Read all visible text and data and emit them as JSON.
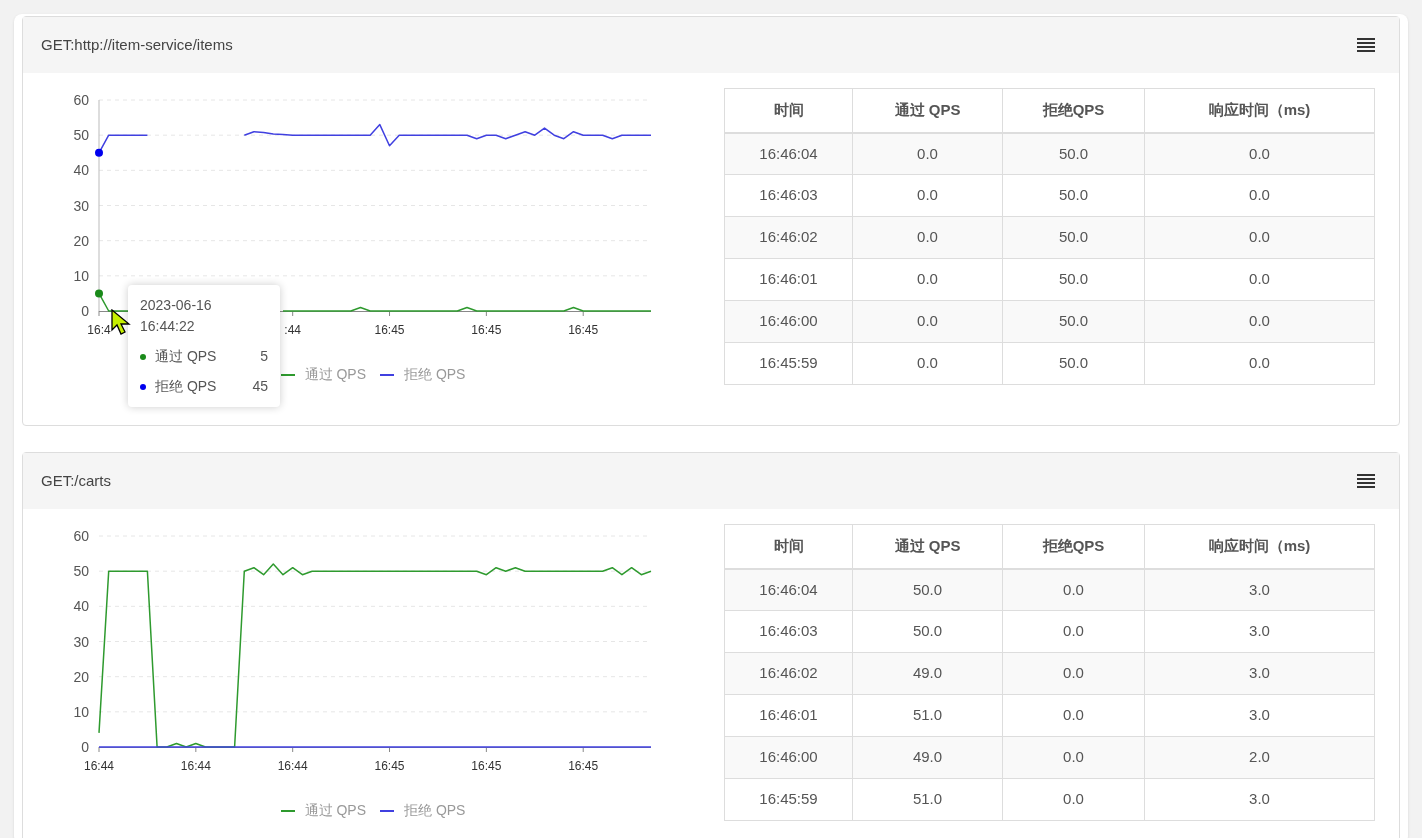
{
  "panels": [
    {
      "title": "GET:http://item-service/items",
      "chart_data": {
        "type": "line",
        "categories": [
          "16:4",
          null,
          null,
          null,
          null,
          null,
          null,
          null,
          null,
          null,
          null,
          null,
          null,
          null,
          null,
          null,
          null,
          null,
          null,
          null,
          ":44",
          null,
          null,
          null,
          null,
          null,
          null,
          null,
          null,
          null,
          "16:45",
          null,
          null,
          null,
          null,
          null,
          null,
          null,
          null,
          null,
          "16:45",
          null,
          null,
          null,
          null,
          null,
          null,
          null,
          null,
          null,
          "16:45",
          null,
          null,
          null,
          null,
          null,
          null,
          null
        ],
        "ylim": [
          0,
          60
        ],
        "yticks": [
          0,
          10,
          20,
          30,
          40,
          50,
          60
        ],
        "grid": true,
        "legend": true,
        "series": [
          {
            "name": "通过 QPS",
            "color": "#2e9a2e",
            "values": [
              5,
              0,
              0,
              0,
              null,
              null,
              null,
              null,
              null,
              null,
              null,
              null,
              null,
              null,
              null,
              null,
              null,
              null,
              null,
              0,
              0,
              0,
              0,
              0,
              0,
              0,
              0,
              1,
              0,
              0,
              0,
              0,
              0,
              0,
              0,
              0,
              0,
              0,
              1,
              0,
              0,
              0,
              0,
              0,
              0,
              0,
              0,
              0,
              0,
              1,
              0,
              0,
              0,
              0,
              0,
              0,
              0,
              0
            ]
          },
          {
            "name": "拒绝 QPS",
            "color": "#4040e0",
            "values": [
              45,
              50,
              50,
              50,
              50,
              50,
              null,
              null,
              null,
              null,
              null,
              null,
              null,
              null,
              null,
              50,
              51,
              50.8,
              50.3,
              50.2,
              50,
              50,
              50,
              50,
              50,
              50,
              50,
              50,
              50,
              53,
              47,
              50,
              50,
              50,
              50,
              50,
              50,
              50,
              50,
              49,
              50,
              50,
              49,
              50,
              51,
              50,
              52,
              50,
              49,
              51,
              50,
              50,
              50,
              49,
              50,
              50,
              50,
              50
            ]
          }
        ]
      },
      "tooltip": {
        "title": "2023-06-16 16:44:22",
        "items": [
          {
            "name": "通过 QPS",
            "value": "5",
            "color": "#1a8a1a"
          },
          {
            "name": "拒绝 QPS",
            "value": "45",
            "color": "#0000ee"
          }
        ]
      },
      "table": {
        "columns": [
          "时间",
          "通过 QPS",
          "拒绝QPS",
          "响应时间（ms)"
        ],
        "rows": [
          [
            "16:46:04",
            "0.0",
            "50.0",
            "0.0"
          ],
          [
            "16:46:03",
            "0.0",
            "50.0",
            "0.0"
          ],
          [
            "16:46:02",
            "0.0",
            "50.0",
            "0.0"
          ],
          [
            "16:46:01",
            "0.0",
            "50.0",
            "0.0"
          ],
          [
            "16:46:00",
            "0.0",
            "50.0",
            "0.0"
          ],
          [
            "16:45:59",
            "0.0",
            "50.0",
            "0.0"
          ]
        ]
      }
    },
    {
      "title": "GET:/carts",
      "chart_data": {
        "type": "line",
        "categories": [
          "16:44",
          null,
          null,
          null,
          null,
          null,
          null,
          null,
          null,
          null,
          "16:44",
          null,
          null,
          null,
          null,
          null,
          null,
          null,
          null,
          null,
          "16:44",
          null,
          null,
          null,
          null,
          null,
          null,
          null,
          null,
          null,
          "16:45",
          null,
          null,
          null,
          null,
          null,
          null,
          null,
          null,
          null,
          "16:45",
          null,
          null,
          null,
          null,
          null,
          null,
          null,
          null,
          null,
          "16:45",
          null,
          null,
          null,
          null,
          null,
          null,
          null
        ],
        "ylim": [
          0,
          60
        ],
        "yticks": [
          0,
          10,
          20,
          30,
          40,
          50,
          60
        ],
        "grid": true,
        "legend": true,
        "series": [
          {
            "name": "通过 QPS",
            "color": "#2e9a2e",
            "values": [
              4,
              50,
              50,
              50,
              50,
              50,
              0,
              0,
              1,
              0,
              1,
              0,
              0,
              0,
              0,
              50,
              51,
              49,
              52,
              49,
              51,
              49,
              50,
              50,
              50,
              50,
              50,
              50,
              50,
              50,
              50,
              50,
              50,
              50,
              50,
              50,
              50,
              50,
              50,
              50,
              49,
              51,
              50,
              51,
              50,
              50,
              50,
              50,
              50,
              50,
              50,
              50,
              50,
              51,
              49,
              51,
              49,
              50
            ]
          },
          {
            "name": "拒绝 QPS",
            "color": "#4040e0",
            "values": [
              0,
              0,
              0,
              0,
              0,
              0,
              0,
              0,
              0,
              0,
              0,
              0,
              0,
              0,
              0,
              0,
              0,
              0,
              0,
              0,
              0,
              0,
              0,
              0,
              0,
              0,
              0,
              0,
              0,
              0,
              0,
              0,
              0,
              0,
              0,
              0,
              0,
              0,
              0,
              0,
              0,
              0,
              0,
              0,
              0,
              0,
              0,
              0,
              0,
              0,
              0,
              0,
              0,
              0,
              0,
              0,
              0,
              0
            ]
          }
        ]
      },
      "table": {
        "columns": [
          "时间",
          "通过 QPS",
          "拒绝QPS",
          "响应时间（ms)"
        ],
        "rows": [
          [
            "16:46:04",
            "50.0",
            "0.0",
            "3.0"
          ],
          [
            "16:46:03",
            "50.0",
            "0.0",
            "3.0"
          ],
          [
            "16:46:02",
            "49.0",
            "0.0",
            "3.0"
          ],
          [
            "16:46:01",
            "51.0",
            "0.0",
            "3.0"
          ],
          [
            "16:46:00",
            "49.0",
            "0.0",
            "2.0"
          ],
          [
            "16:45:59",
            "51.0",
            "0.0",
            "3.0"
          ]
        ]
      }
    }
  ]
}
